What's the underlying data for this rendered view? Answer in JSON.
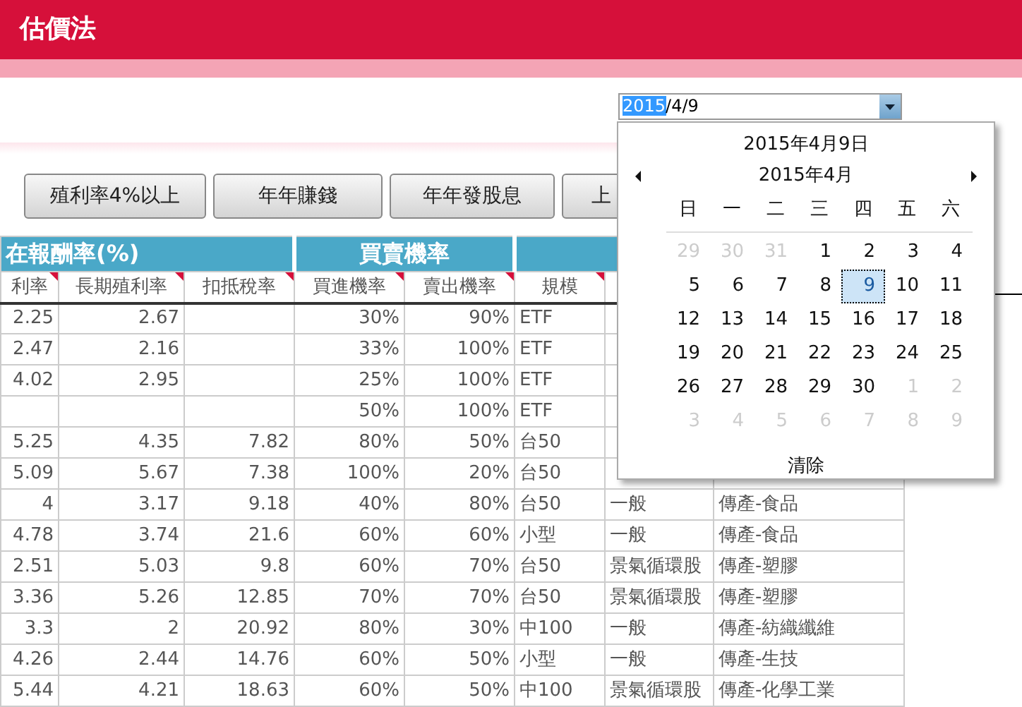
{
  "header": {
    "title": "估價法"
  },
  "date_field": {
    "value_parts": [
      {
        "text": "2015",
        "highlighted": true
      },
      {
        "text": "/4/9",
        "highlighted": false
      }
    ]
  },
  "filter_buttons": [
    "殖利率4%以上",
    "年年賺錢",
    "年年發股息",
    "上"
  ],
  "table": {
    "groups": [
      {
        "label": "在報酬率(%)"
      },
      {
        "label": "買賣機率"
      }
    ],
    "columns": [
      {
        "label": "利率",
        "flagged": true
      },
      {
        "label": "長期殖利率",
        "flagged": true
      },
      {
        "label": "扣抵稅率",
        "flagged": true
      },
      {
        "label": "買進機率",
        "flagged": true
      },
      {
        "label": "賣出機率",
        "flagged": true
      },
      {
        "label": "規模",
        "flagged": true
      }
    ],
    "rows": [
      [
        "2.25",
        "2.67",
        null,
        "30%",
        "90%",
        "ETF",
        null,
        null
      ],
      [
        "2.47",
        "2.16",
        null,
        "33%",
        "100%",
        "ETF",
        null,
        null
      ],
      [
        "4.02",
        "2.95",
        null,
        "25%",
        "100%",
        "ETF",
        null,
        null
      ],
      [
        null,
        null,
        null,
        "50%",
        "100%",
        "ETF",
        null,
        null
      ],
      [
        "5.25",
        "4.35",
        "7.82",
        "80%",
        "50%",
        "台50",
        null,
        null
      ],
      [
        "5.09",
        "5.67",
        "7.38",
        "100%",
        "20%",
        "台50",
        null,
        null
      ],
      [
        "4",
        "3.17",
        "9.18",
        "40%",
        "80%",
        "台50",
        "一般",
        "傳產-食品"
      ],
      [
        "4.78",
        "3.74",
        "21.6",
        "60%",
        "60%",
        "小型",
        "一般",
        "傳產-食品"
      ],
      [
        "2.51",
        "5.03",
        "9.8",
        "60%",
        "70%",
        "台50",
        "景氣循環股",
        "傳產-塑膠"
      ],
      [
        "3.36",
        "5.26",
        "12.85",
        "70%",
        "70%",
        "台50",
        "景氣循環股",
        "傳產-塑膠"
      ],
      [
        "3.3",
        "2",
        "20.92",
        "80%",
        "30%",
        "中100",
        "一般",
        "傳產-紡織纖維"
      ],
      [
        "4.26",
        "2.44",
        "14.76",
        "60%",
        "50%",
        "小型",
        "一般",
        "傳產-生技"
      ],
      [
        "5.44",
        "4.21",
        "18.63",
        "60%",
        "50%",
        "中100",
        "景氣循環股",
        "傳產-化學工業"
      ]
    ]
  },
  "calendar": {
    "date_title": "2015年4月9日",
    "month_title": "2015年4月",
    "weekdays": [
      "日",
      "一",
      "二",
      "三",
      "四",
      "五",
      "六"
    ],
    "days": [
      {
        "label": "29",
        "other_month": true,
        "selected": false
      },
      {
        "label": "30",
        "other_month": true,
        "selected": false
      },
      {
        "label": "31",
        "other_month": true,
        "selected": false
      },
      {
        "label": "1",
        "other_month": false,
        "selected": false
      },
      {
        "label": "2",
        "other_month": false,
        "selected": false
      },
      {
        "label": "3",
        "other_month": false,
        "selected": false
      },
      {
        "label": "4",
        "other_month": false,
        "selected": false
      },
      {
        "label": "5",
        "other_month": false,
        "selected": false
      },
      {
        "label": "6",
        "other_month": false,
        "selected": false
      },
      {
        "label": "7",
        "other_month": false,
        "selected": false
      },
      {
        "label": "8",
        "other_month": false,
        "selected": false
      },
      {
        "label": "9",
        "other_month": false,
        "selected": true
      },
      {
        "label": "10",
        "other_month": false,
        "selected": false
      },
      {
        "label": "11",
        "other_month": false,
        "selected": false
      },
      {
        "label": "12",
        "other_month": false,
        "selected": false
      },
      {
        "label": "13",
        "other_month": false,
        "selected": false
      },
      {
        "label": "14",
        "other_month": false,
        "selected": false
      },
      {
        "label": "15",
        "other_month": false,
        "selected": false
      },
      {
        "label": "16",
        "other_month": false,
        "selected": false
      },
      {
        "label": "17",
        "other_month": false,
        "selected": false
      },
      {
        "label": "18",
        "other_month": false,
        "selected": false
      },
      {
        "label": "19",
        "other_month": false,
        "selected": false
      },
      {
        "label": "20",
        "other_month": false,
        "selected": false
      },
      {
        "label": "21",
        "other_month": false,
        "selected": false
      },
      {
        "label": "22",
        "other_month": false,
        "selected": false
      },
      {
        "label": "23",
        "other_month": false,
        "selected": false
      },
      {
        "label": "24",
        "other_month": false,
        "selected": false
      },
      {
        "label": "25",
        "other_month": false,
        "selected": false
      },
      {
        "label": "26",
        "other_month": false,
        "selected": false
      },
      {
        "label": "27",
        "other_month": false,
        "selected": false
      },
      {
        "label": "28",
        "other_month": false,
        "selected": false
      },
      {
        "label": "29",
        "other_month": false,
        "selected": false
      },
      {
        "label": "30",
        "other_month": false,
        "selected": false
      },
      {
        "label": "1",
        "other_month": true,
        "selected": false
      },
      {
        "label": "2",
        "other_month": true,
        "selected": false
      },
      {
        "label": "3",
        "other_month": true,
        "selected": false
      },
      {
        "label": "4",
        "other_month": true,
        "selected": false
      },
      {
        "label": "5",
        "other_month": true,
        "selected": false
      },
      {
        "label": "6",
        "other_month": true,
        "selected": false
      },
      {
        "label": "7",
        "other_month": true,
        "selected": false
      },
      {
        "label": "8",
        "other_month": true,
        "selected": false
      },
      {
        "label": "9",
        "other_month": true,
        "selected": false
      }
    ],
    "clear_label": "清除"
  }
}
